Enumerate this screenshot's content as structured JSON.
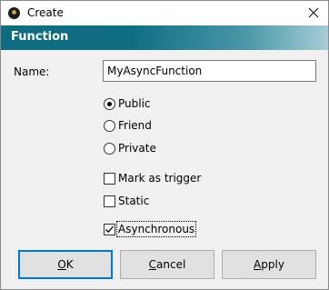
{
  "window": {
    "title": "Create",
    "close_icon": "close-icon"
  },
  "header": {
    "title": "Function"
  },
  "form": {
    "name_label": "Name:",
    "name_value": "MyAsyncFunction",
    "visibility_options": [
      {
        "label": "Public",
        "selected": true
      },
      {
        "label": "Friend",
        "selected": false
      },
      {
        "label": "Private",
        "selected": false
      }
    ],
    "checkboxes": [
      {
        "label": "Mark as trigger",
        "checked": false
      },
      {
        "label": "Static",
        "checked": false
      },
      {
        "label": "Asynchronous",
        "checked": true
      }
    ]
  },
  "buttons": {
    "ok": {
      "mnemonic": "O",
      "rest": "K"
    },
    "cancel": {
      "mnemonic": "C",
      "rest": "ancel"
    },
    "apply": {
      "mnemonic": "A",
      "rest": "pply"
    }
  }
}
